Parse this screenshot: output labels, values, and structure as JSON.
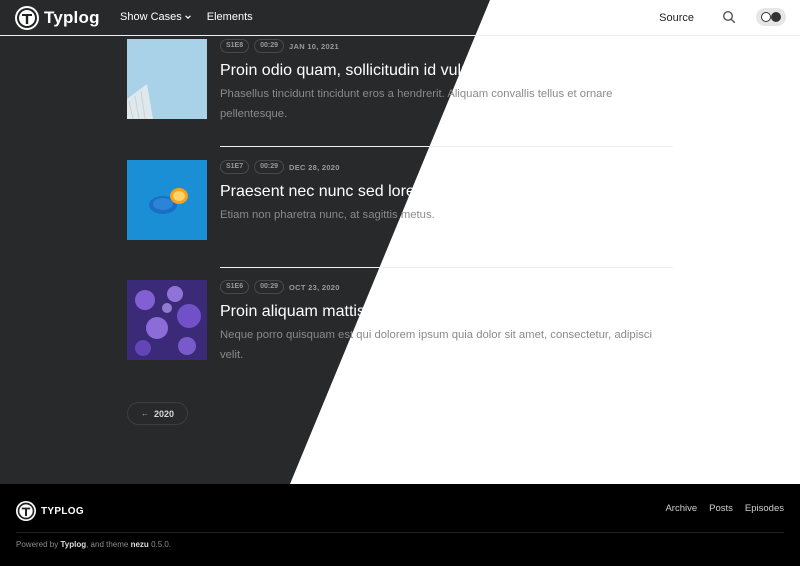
{
  "header": {
    "logo_text": "Typlog",
    "nav": [
      {
        "label": "Show Cases",
        "has_dropdown": true
      },
      {
        "label": "Elements",
        "has_dropdown": false
      }
    ],
    "source_label": "Source",
    "icons": {
      "search": "search-icon",
      "theme_toggle": "theme-toggle-icon"
    }
  },
  "episodes": [
    {
      "season_episode": "S1E8",
      "duration": "00:29",
      "date": "JAN 10, 2021",
      "title": "Proin odio quam, sollicitudin id vulputate",
      "description": "Phasellus tincidunt tincidunt eros a hendrerit. Aliquam convallis tellus et ornare pellentesque.",
      "thumbnail": "building-sky-image"
    },
    {
      "season_episode": "S1E7",
      "duration": "00:29",
      "date": "DEC 28, 2020",
      "title": "Praesent nec nunc sed lorem",
      "description": "Etiam non pharetra nunc, at sagittis metus.",
      "thumbnail": "lemon-on-blue-image"
    },
    {
      "season_episode": "S1E6",
      "duration": "00:29",
      "date": "OCT 23, 2020",
      "title": "Proin aliquam mattis felis non condimentum",
      "description": "Neque porro quisquam est qui dolorem ipsum quia dolor sit amet, consectetur, adipisci velit.",
      "thumbnail": "jellyfish-image"
    }
  ],
  "pagination": {
    "arrow": "←",
    "label": "2020"
  },
  "footer": {
    "logo_text": "TYPLOG",
    "links": [
      "Archive",
      "Posts",
      "Episodes"
    ],
    "powered_prefix": "Powered by",
    "powered_brand": "Typlog",
    "powered_mid": ", and theme",
    "theme_name": "nezu",
    "theme_version": "0.5.0."
  },
  "colors": {
    "dark_bg": "#28292b",
    "light_bg": "#ffffff",
    "footer_bg": "#000000"
  }
}
